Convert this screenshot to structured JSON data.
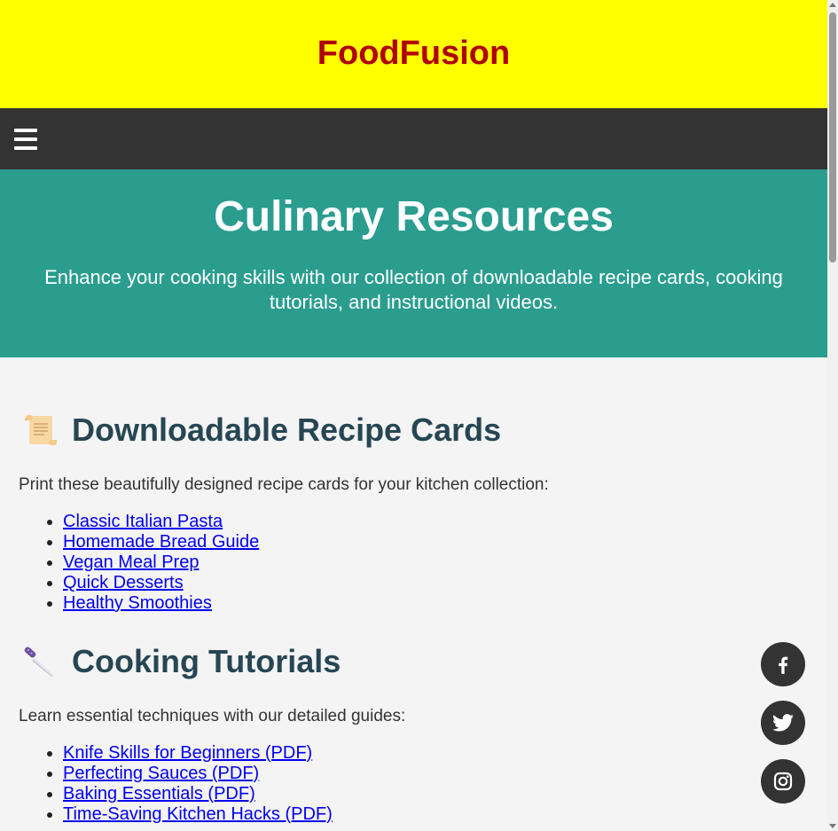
{
  "header": {
    "brand": "FoodFusion"
  },
  "nav": {
    "menu_icon": "hamburger-menu-icon"
  },
  "hero": {
    "title": "Culinary Resources",
    "subtitle": "Enhance your cooking skills with our collection of downloadable recipe cards, cooking tutorials, and instructional videos."
  },
  "recipe_cards": {
    "icon": "scroll-icon",
    "heading": "Downloadable Recipe Cards",
    "intro": "Print these beautifully designed recipe cards for your kitchen collection:",
    "items": [
      "Classic Italian Pasta",
      "Homemade Bread Guide",
      "Vegan Meal Prep",
      "Quick Desserts",
      "Healthy Smoothies"
    ]
  },
  "tutorials": {
    "icon": "knife-icon",
    "heading": "Cooking Tutorials",
    "intro": "Learn essential techniques with our detailed guides:",
    "items": [
      "Knife Skills for Beginners (PDF)",
      "Perfecting Sauces (PDF)",
      "Baking Essentials (PDF)",
      "Time-Saving Kitchen Hacks (PDF)"
    ]
  },
  "social": [
    "facebook-icon",
    "twitter-icon",
    "instagram-icon"
  ],
  "colors": {
    "header_bg": "#ffff00",
    "brand": "#b00000",
    "nav_bg": "#333333",
    "hero_bg": "#2a9d8f",
    "heading": "#264653",
    "link": "#0000ee"
  }
}
